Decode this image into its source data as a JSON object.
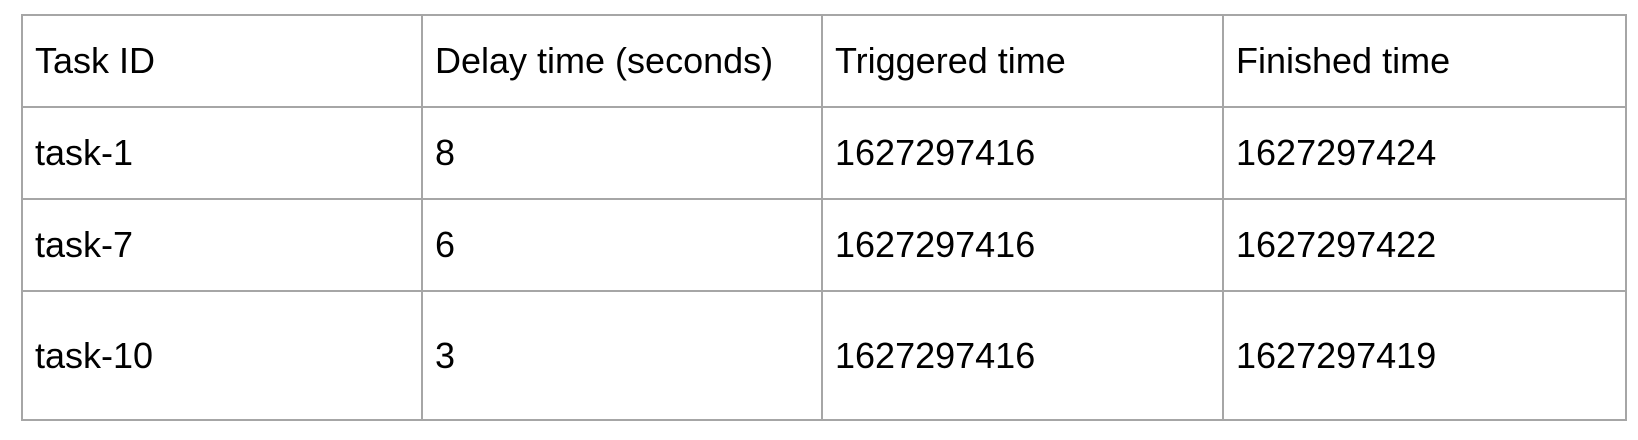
{
  "table": {
    "headers": [
      "Task ID",
      "Delay time (seconds)",
      "Triggered time",
      "Finished time"
    ],
    "rows": [
      [
        "task-1",
        "8",
        "1627297416",
        "1627297424"
      ],
      [
        "task-7",
        "6",
        "1627297416",
        "1627297422"
      ],
      [
        "task-10",
        "3",
        "1627297416",
        "1627297419"
      ]
    ]
  }
}
